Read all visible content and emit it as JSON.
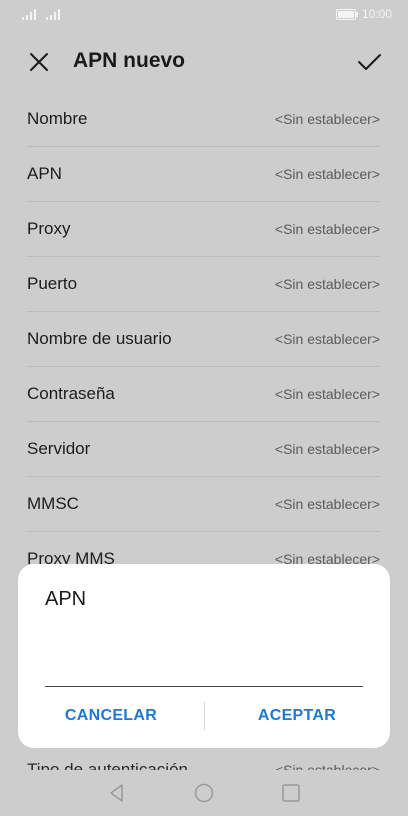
{
  "status_bar": {
    "time": "10:00"
  },
  "app_bar": {
    "title": "APN nuevo"
  },
  "settings": [
    {
      "label": "Nombre",
      "value": "<Sin establecer>"
    },
    {
      "label": "APN",
      "value": "<Sin establecer>"
    },
    {
      "label": "Proxy",
      "value": "<Sin establecer>"
    },
    {
      "label": "Puerto",
      "value": "<Sin establecer>"
    },
    {
      "label": "Nombre de usuario",
      "value": "<Sin establecer>"
    },
    {
      "label": "Contraseña",
      "value": "<Sin establecer>"
    },
    {
      "label": "Servidor",
      "value": "<Sin establecer>"
    },
    {
      "label": "MMSC",
      "value": "<Sin establecer>"
    },
    {
      "label": "Proxy MMS",
      "value": "<Sin establecer>"
    }
  ],
  "peek_row": {
    "label": "Tipo de autenticación",
    "value": "<Sin establecer>"
  },
  "dialog": {
    "title": "APN",
    "input_value": "",
    "cancel_label": "CANCELAR",
    "accept_label": "ACEPTAR"
  },
  "colors": {
    "accent": "#1e78d6",
    "background": "#cdcdcd",
    "dialog": "#ffffff"
  },
  "icons": {
    "close": "close-icon",
    "confirm": "check-icon",
    "back": "back-icon",
    "home": "home-icon",
    "recent": "recent-apps-icon"
  }
}
